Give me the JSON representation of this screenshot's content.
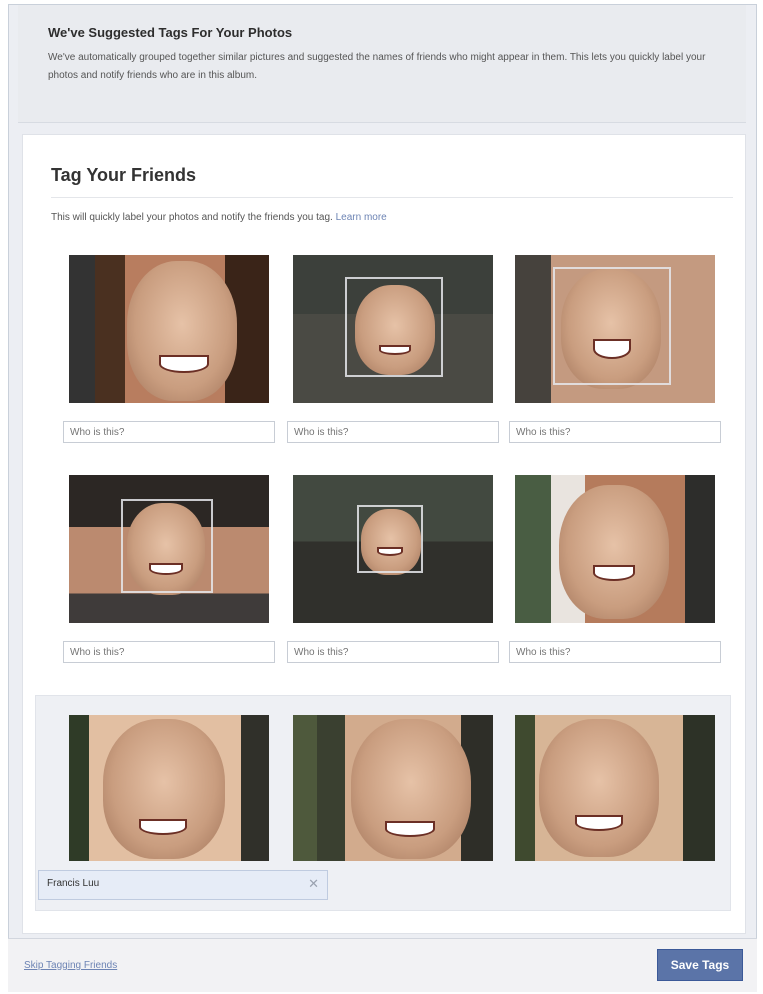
{
  "banner": {
    "title": "We've Suggested Tags For Your Photos",
    "text": "We've automatically grouped together similar pictures and suggested the names of friends who might appear in them. This lets you quickly label your photos and notify friends who are in this album."
  },
  "card": {
    "title": "Tag Your Friends",
    "subtitle": "This will quickly label your photos and notify the friends you tag.",
    "learn_more": "Learn more"
  },
  "photos": {
    "inputs": [
      {
        "placeholder": "Who is this?"
      },
      {
        "placeholder": "Who is this?"
      },
      {
        "placeholder": "Who is this?"
      },
      {
        "placeholder": "Who is this?"
      },
      {
        "placeholder": "Who is this?"
      },
      {
        "placeholder": "Who is this?"
      }
    ]
  },
  "group": {
    "tag_value": "Francis Luu",
    "remove_icon": "close-icon"
  },
  "footer": {
    "skip_label": "Skip Tagging Friends",
    "save_label": "Save Tags"
  },
  "colors": {
    "link": "#6d84b4",
    "save_button": "#5b74a8",
    "tag_field": "#e6ecf7"
  }
}
